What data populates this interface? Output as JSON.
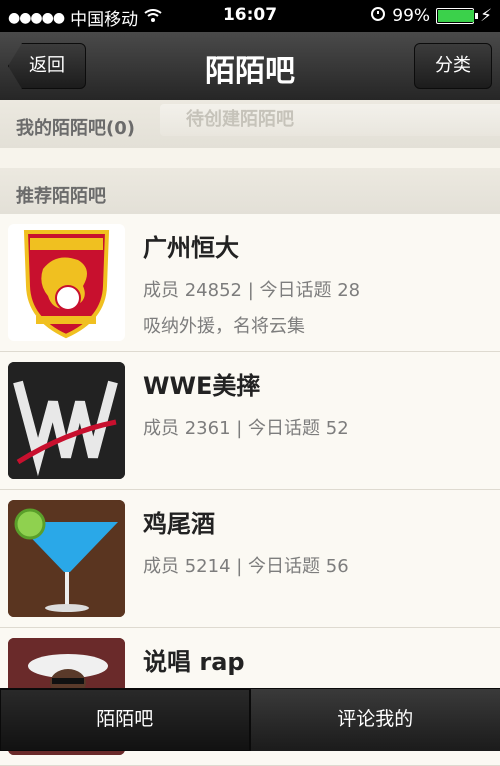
{
  "status_bar": {
    "carrier": "中国移动",
    "time": "16:07",
    "battery": "99%",
    "battery_level": 0.99
  },
  "navbar": {
    "title": "陌陌吧",
    "back_label": "返回",
    "category_label": "分类"
  },
  "my_section": {
    "label": "我的陌陌吧(0)",
    "pending_text": "待创建陌陌吧"
  },
  "recommended_section": {
    "label": "推荐陌陌吧"
  },
  "items": [
    {
      "name": "广州恒大",
      "meta": "成员 24852 | 今日话题 28",
      "desc": "吸纳外援，名将云集",
      "thumb_icon": "evergrande-crest"
    },
    {
      "name": "WWE美摔",
      "meta": "成员 2361 | 今日话题 52",
      "desc": "",
      "thumb_icon": "wwe-logo"
    },
    {
      "name": "鸡尾酒",
      "meta": "成员 5214 | 今日话题 56",
      "desc": "",
      "thumb_icon": "cocktail-glass"
    },
    {
      "name": "说唱 rap",
      "meta": "",
      "desc": "",
      "thumb_icon": "rapper-photo"
    }
  ],
  "tabs": [
    {
      "label": "陌陌吧",
      "active": true
    },
    {
      "label": "评论我的",
      "active": false
    }
  ]
}
